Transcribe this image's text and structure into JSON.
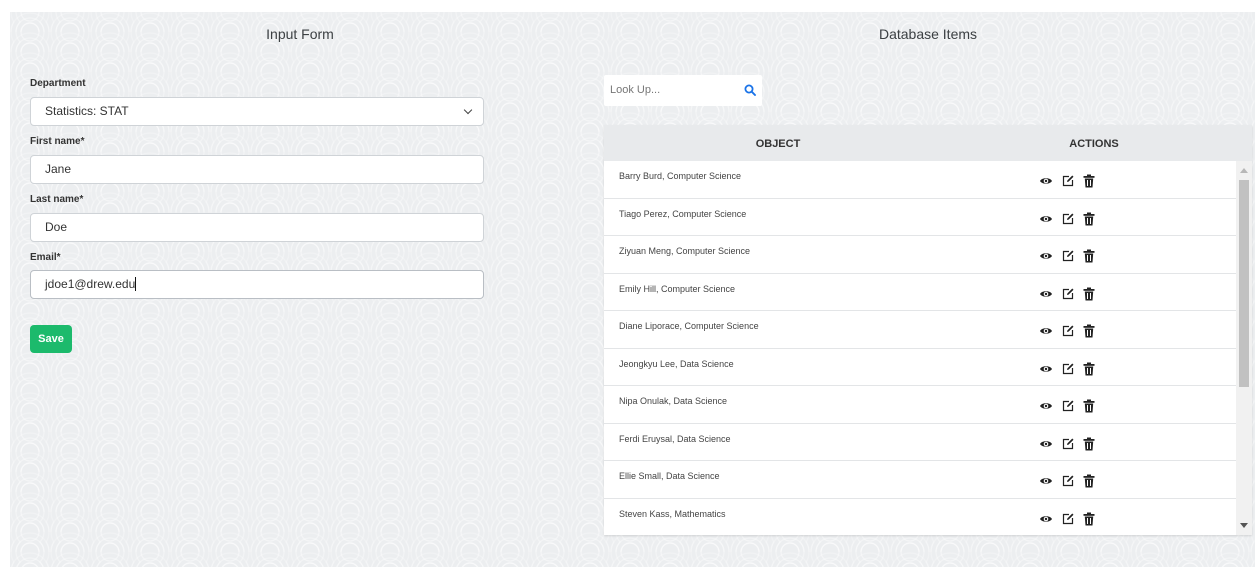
{
  "headings": {
    "input_form": "Input Form",
    "database_items": "Database Items"
  },
  "form": {
    "department_label": "Department",
    "department_value": "Statistics: STAT",
    "first_name_label": "First name*",
    "first_name_value": "Jane",
    "last_name_label": "Last name*",
    "last_name_value": "Doe",
    "email_label": "Email*",
    "email_value": "jdoe1@drew.edu",
    "save_label": "Save"
  },
  "search": {
    "placeholder": "Look Up..."
  },
  "table": {
    "headers": {
      "object": "OBJECT",
      "actions": "ACTIONS"
    },
    "rows": [
      "Barry Burd, Computer Science",
      "Tiago Perez, Computer Science",
      "Ziyuan Meng, Computer Science",
      "Emily Hill, Computer Science",
      "Diane Liporace, Computer Science",
      "Jeongkyu Lee, Data Science",
      "Nipa Onulak, Data Science",
      "Ferdi Eruysal, Data Science",
      "Ellie Small, Data Science",
      "Steven Kass, Mathematics"
    ],
    "row_icons": [
      "eye-icon",
      "edit-icon",
      "trash-icon"
    ]
  },
  "colors": {
    "save_button": "#1cba6c",
    "search_icon": "#1a73e8",
    "header_bg": "#e8eaec"
  }
}
